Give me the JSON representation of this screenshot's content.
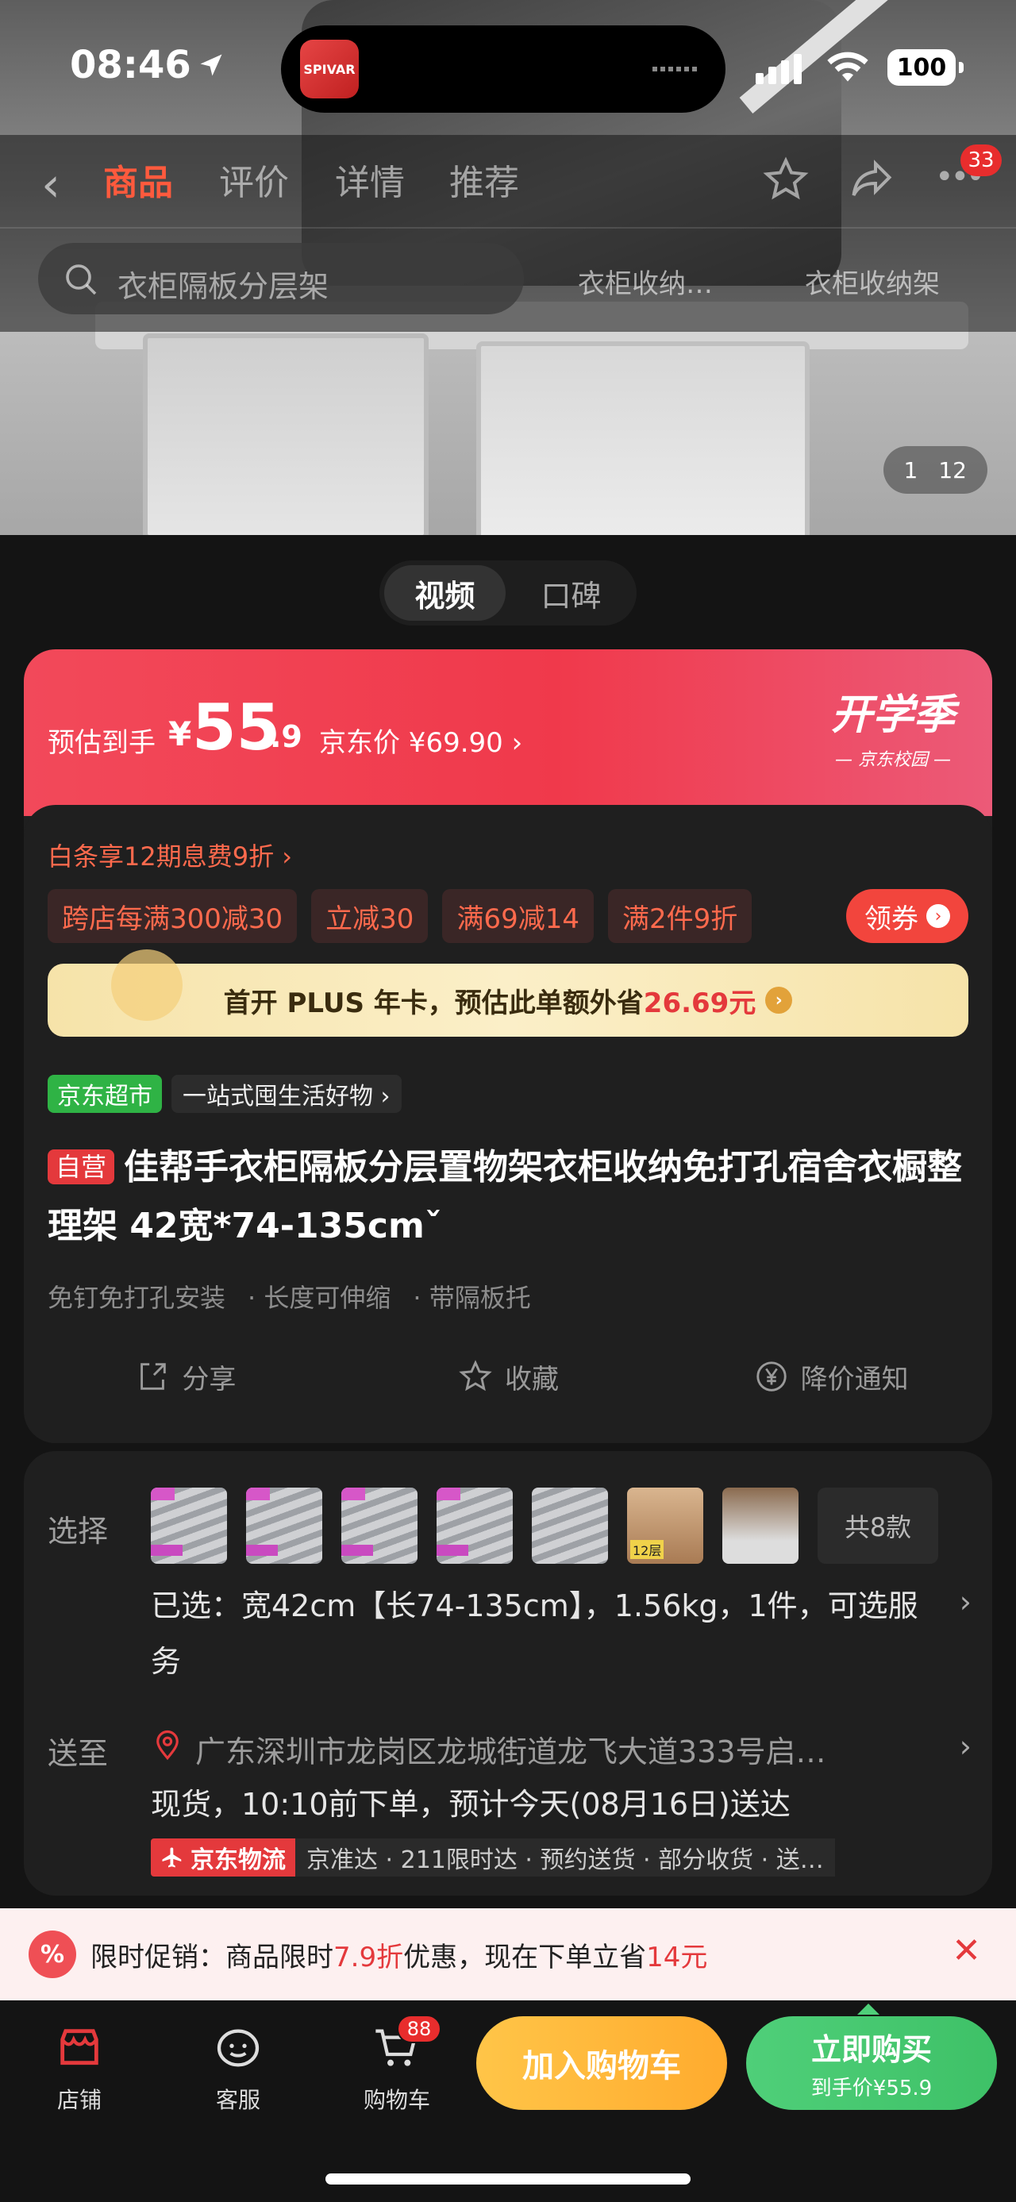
{
  "status": {
    "time": "08:46",
    "battery": "100",
    "app_icon_text": "SPIVAR"
  },
  "hero": {
    "image_index": "1",
    "image_total": "12"
  },
  "nav": {
    "tabs": [
      {
        "label": "商品"
      },
      {
        "label": "评价"
      },
      {
        "label": "详情"
      },
      {
        "label": "推荐"
      }
    ],
    "more_badge": "33"
  },
  "search": {
    "placeholder": "衣柜隔板分层架",
    "hot": [
      "衣柜收纳…",
      "衣柜收纳架"
    ]
  },
  "media_toggle": [
    "视频",
    "口碑"
  ],
  "price": {
    "label": "预估到手",
    "currency": "¥",
    "integer": "55",
    "decimal": ".9",
    "jd_price": "京东价 ¥69.90 ›",
    "campaign_title": "开学季",
    "campaign_sub": "— 京东校园 —"
  },
  "promo_info": {
    "baitiao": "白条享12期息费9折 ›",
    "chips": [
      "跨店每满300减30",
      "立减30",
      "满69减14",
      "满2件9折"
    ],
    "coupon_btn": "领券",
    "plus_prefix": "首开 PLUS 年卡，预估此单额外省",
    "plus_amount": "26.69元"
  },
  "store": {
    "tag": "京东超市",
    "slogan": "一站式囤生活好物 ›"
  },
  "product": {
    "self_tag": "自营",
    "title": "佳帮手衣柜隔板分层置物架衣柜收纳免打孔宿舍衣橱整理架 42宽*74-135cm",
    "title_suffix": "ˇ",
    "features": [
      "免钉免打孔安装",
      "· 长度可伸缩",
      "· 带隔板托"
    ]
  },
  "actions": [
    "分享",
    "收藏",
    "降价通知"
  ],
  "spec": {
    "choose_label": "选择",
    "thumbs_badge": "12层",
    "total": "共8款",
    "selected": "已选：宽42cm【长74-135cm】，1.56kg，1件，可选服务",
    "ship_label": "送至",
    "address": "广东深圳市龙岗区龙城街道龙飞大道333号启…",
    "stock": "现货，10:10前下单，预计今天(08月16日)送达",
    "logistics": "京东物流",
    "services": "京准达 · 211限时达 · 预约送货 · 部分收货 · 送…"
  },
  "promo_bar": {
    "icon": "%",
    "text_a": "限时促销：商品限时",
    "discount": "7.9折",
    "text_b": "优惠，现在下单立省",
    "save": "14元"
  },
  "bottom": {
    "shop": "店铺",
    "service": "客服",
    "cart": "购物车",
    "cart_badge": "88",
    "add_cart": "加入购物车",
    "buy_now": "立即购买",
    "buy_price": "到手价¥55.9"
  }
}
